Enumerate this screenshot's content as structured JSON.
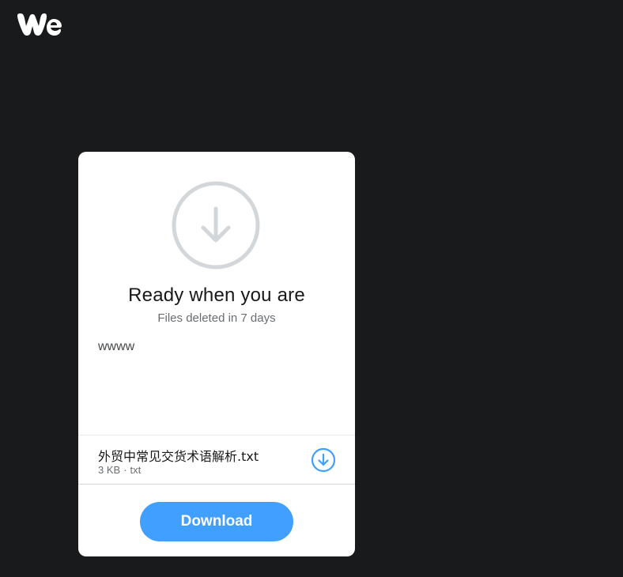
{
  "brand": {
    "logo_icon": "wetransfer-we-logo-icon",
    "logo_color": "#ffffff"
  },
  "background_color": "#191a1c",
  "card": {
    "hero_icon": "download-arrow-circle-icon",
    "hero_icon_color": "#d4d7d9",
    "title": "Ready when you are",
    "subtitle": "Files deleted in 7 days",
    "message": "wwww",
    "file": {
      "name": "外贸中常见交货术语解析.txt",
      "size": "3 KB",
      "separator": "·",
      "type": "txt",
      "download_icon": "download-circle-icon",
      "download_icon_color": "#409fff"
    },
    "download_button": {
      "label": "Download",
      "color": "#409fff"
    }
  }
}
